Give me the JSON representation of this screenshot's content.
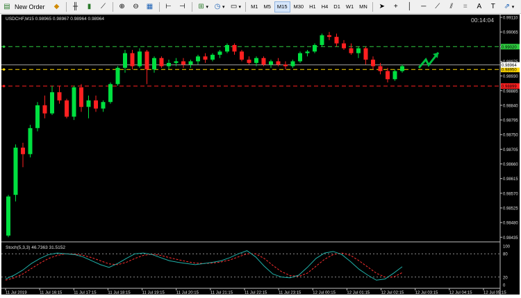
{
  "toolbar": {
    "new_order_label": "New Order",
    "timeframes": [
      "M1",
      "M5",
      "M15",
      "M30",
      "H1",
      "H4",
      "D1",
      "W1",
      "MN"
    ],
    "active_timeframe": "M15"
  },
  "chart": {
    "header": "USDCHF,M15  0.98965 0.98967 0.98964 0.98964",
    "timer": "00:14:04"
  },
  "chart_data": {
    "type": "candlestick",
    "symbol": "USDCHF",
    "timeframe": "M15",
    "ylim": [
      0.98425,
      0.9911
    ],
    "price_ticks": [
      "0.99110",
      "0.99065",
      "0.99020",
      "0.98975",
      "0.98930",
      "0.98885",
      "0.98840",
      "0.98795",
      "0.98750",
      "0.98705",
      "0.98660",
      "0.98615",
      "0.98570",
      "0.98525",
      "0.98480",
      "0.98435"
    ],
    "x_labels": [
      "11 Jul 2019",
      "11 Jul 16:15",
      "11 Jul 17:15",
      "11 Jul 18:15",
      "11 Jul 19:15",
      "11 Jul 20:15",
      "11 Jul 21:15",
      "11 Jul 22:15",
      "11 Jul 23:15",
      "12 Jul 00:15",
      "12 Jul 01:15",
      "12 Jul 02:15",
      "12 Jul 03:15",
      "12 Jul 04:15",
      "12 Jul 05:15"
    ],
    "candles": [
      [
        0.9844,
        0.98565,
        0.98435,
        0.9856
      ],
      [
        0.98565,
        0.9872,
        0.98545,
        0.9871
      ],
      [
        0.9871,
        0.98725,
        0.9865,
        0.9869
      ],
      [
        0.9869,
        0.9878,
        0.9868,
        0.9877
      ],
      [
        0.9877,
        0.9885,
        0.9876,
        0.9884
      ],
      [
        0.9884,
        0.9887,
        0.988,
        0.98815
      ],
      [
        0.98815,
        0.989,
        0.9881,
        0.9888
      ],
      [
        0.9888,
        0.989,
        0.98845,
        0.98855
      ],
      [
        0.98855,
        0.9886,
        0.988,
        0.98805
      ],
      [
        0.98805,
        0.989,
        0.98795,
        0.98895
      ],
      [
        0.98895,
        0.98905,
        0.9882,
        0.98835
      ],
      [
        0.98835,
        0.9887,
        0.988,
        0.98855
      ],
      [
        0.98855,
        0.9887,
        0.9882,
        0.9883
      ],
      [
        0.9883,
        0.98855,
        0.9882,
        0.9885
      ],
      [
        0.9885,
        0.9891,
        0.98845,
        0.98905
      ],
      [
        0.98905,
        0.9896,
        0.989,
        0.98955
      ],
      [
        0.98955,
        0.9901,
        0.9894,
        0.99
      ],
      [
        0.99,
        0.9901,
        0.9895,
        0.9896
      ],
      [
        0.9896,
        0.99015,
        0.98955,
        0.99005
      ],
      [
        0.99005,
        0.9901,
        0.98905,
        0.9895
      ],
      [
        0.9895,
        0.9899,
        0.9894,
        0.98985
      ],
      [
        0.98985,
        0.9899,
        0.98955,
        0.9896
      ],
      [
        0.9896,
        0.9898,
        0.9895,
        0.9897
      ],
      [
        0.9897,
        0.98985,
        0.9896,
        0.98975
      ],
      [
        0.98975,
        0.98985,
        0.98955,
        0.98965
      ],
      [
        0.98965,
        0.9898,
        0.98955,
        0.98975
      ],
      [
        0.98975,
        0.98995,
        0.98965,
        0.9899
      ],
      [
        0.9899,
        0.99,
        0.9897,
        0.9898
      ],
      [
        0.9898,
        0.99,
        0.98975,
        0.98995
      ],
      [
        0.98995,
        0.9901,
        0.98985,
        0.99005
      ],
      [
        0.99005,
        0.9903,
        0.99,
        0.99025
      ],
      [
        0.99025,
        0.9903,
        0.98995,
        0.99005
      ],
      [
        0.99005,
        0.9901,
        0.98975,
        0.9898
      ],
      [
        0.9898,
        0.9899,
        0.98965,
        0.9897
      ],
      [
        0.9897,
        0.9899,
        0.9896,
        0.98985
      ],
      [
        0.98985,
        0.9899,
        0.9896,
        0.98965
      ],
      [
        0.98965,
        0.9898,
        0.98955,
        0.98975
      ],
      [
        0.98975,
        0.98985,
        0.9896,
        0.98965
      ],
      [
        0.98965,
        0.98975,
        0.9895,
        0.9896
      ],
      [
        0.9896,
        0.9898,
        0.98955,
        0.98975
      ],
      [
        0.98975,
        0.99005,
        0.9897,
        0.99
      ],
      [
        0.99,
        0.9901,
        0.9899,
        0.99005
      ],
      [
        0.99005,
        0.9903,
        0.99,
        0.99025
      ],
      [
        0.99025,
        0.9906,
        0.9902,
        0.99055
      ],
      [
        0.99055,
        0.99065,
        0.9904,
        0.9905
      ],
      [
        0.9905,
        0.9906,
        0.9902,
        0.9903
      ],
      [
        0.9903,
        0.9904,
        0.9901,
        0.99015
      ],
      [
        0.99015,
        0.9903,
        0.98995,
        0.99
      ],
      [
        0.99,
        0.9902,
        0.98985,
        0.99015
      ],
      [
        0.99015,
        0.9902,
        0.98965,
        0.9898
      ],
      [
        0.9898,
        0.9899,
        0.9895,
        0.9896
      ],
      [
        0.9896,
        0.9897,
        0.98935,
        0.98945
      ],
      [
        0.98945,
        0.98955,
        0.9891,
        0.9892
      ],
      [
        0.9892,
        0.9895,
        0.98915,
        0.98945
      ],
      [
        0.98945,
        0.98965,
        0.9894,
        0.9896
      ]
    ],
    "levels": [
      {
        "price": 0.9902,
        "label": "0.99020",
        "color": "#2ecc40"
      },
      {
        "price": 0.9895,
        "label": "0.98950",
        "color": "#ffd700"
      },
      {
        "price": 0.98899,
        "label": "0.98899",
        "color": "#ff2020"
      }
    ],
    "current": {
      "price": 0.98964,
      "label": "0.98964"
    },
    "stoch": {
      "title": "Stoch(5,3,3) 46.7363 31.5152",
      "ylim": [
        0,
        100
      ],
      "levels": [
        20,
        80
      ],
      "tick_labels": [
        "100",
        "80",
        "20",
        "0"
      ],
      "main": [
        15,
        25,
        38,
        55,
        68,
        78,
        82,
        80,
        78,
        72,
        62,
        52,
        45,
        55,
        68,
        80,
        82,
        78,
        70,
        62,
        58,
        55,
        52,
        55,
        58,
        62,
        70,
        80,
        88,
        72,
        48,
        28,
        20,
        18,
        25,
        45,
        68,
        82,
        86,
        78,
        60,
        40,
        25,
        12,
        15,
        30,
        46.7
      ],
      "signal": [
        12,
        18,
        28,
        42,
        56,
        68,
        76,
        80,
        79,
        76,
        70,
        62,
        54,
        52,
        58,
        68,
        76,
        79,
        76,
        70,
        65,
        60,
        56,
        55,
        56,
        59,
        64,
        72,
        80,
        80,
        68,
        50,
        34,
        24,
        22,
        30,
        48,
        66,
        78,
        82,
        76,
        62,
        46,
        30,
        20,
        20,
        31.5
      ]
    }
  },
  "colors": {
    "bull": "#00e040",
    "bear": "#ff2020",
    "grid_text": "#e0e0e0",
    "stoch_main": "#20b2aa",
    "stoch_signal": "#ff3030",
    "arrow": "#00c040"
  }
}
